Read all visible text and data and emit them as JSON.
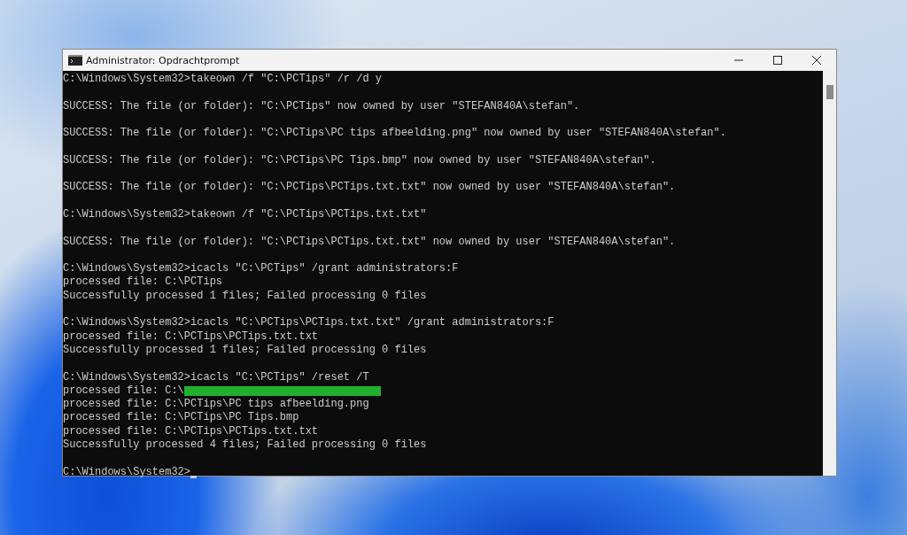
{
  "window": {
    "title": "Administrator: Opdrachtprompt"
  },
  "console": {
    "lines": [
      {
        "kind": "text",
        "text": "C:\\Windows\\System32>takeown /f \"C:\\PCTips\" /r /d y"
      },
      {
        "kind": "blank"
      },
      {
        "kind": "text",
        "text": "SUCCESS: The file (or folder): \"C:\\PCTips\" now owned by user \"STEFAN840A\\stefan\"."
      },
      {
        "kind": "blank"
      },
      {
        "kind": "text",
        "text": "SUCCESS: The file (or folder): \"C:\\PCTips\\PC tips afbeelding.png\" now owned by user \"STEFAN840A\\stefan\"."
      },
      {
        "kind": "blank"
      },
      {
        "kind": "text",
        "text": "SUCCESS: The file (or folder): \"C:\\PCTips\\PC Tips.bmp\" now owned by user \"STEFAN840A\\stefan\"."
      },
      {
        "kind": "blank"
      },
      {
        "kind": "text",
        "text": "SUCCESS: The file (or folder): \"C:\\PCTips\\PCTips.txt.txt\" now owned by user \"STEFAN840A\\stefan\"."
      },
      {
        "kind": "blank"
      },
      {
        "kind": "text",
        "text": "C:\\Windows\\System32>takeown /f \"C:\\PCTips\\PCTips.txt.txt\""
      },
      {
        "kind": "blank"
      },
      {
        "kind": "text",
        "text": "SUCCESS: The file (or folder): \"C:\\PCTips\\PCTips.txt.txt\" now owned by user \"STEFAN840A\\stefan\"."
      },
      {
        "kind": "blank"
      },
      {
        "kind": "text",
        "text": "C:\\Windows\\System32>icacls \"C:\\PCTips\" /grant administrators:F"
      },
      {
        "kind": "text",
        "text": "processed file: C:\\PCTips"
      },
      {
        "kind": "text",
        "text": "Successfully processed 1 files; Failed processing 0 files"
      },
      {
        "kind": "blank"
      },
      {
        "kind": "text",
        "text": "C:\\Windows\\System32>icacls \"C:\\PCTips\\PCTips.txt.txt\" /grant administrators:F"
      },
      {
        "kind": "text",
        "text": "processed file: C:\\PCTips\\PCTips.txt.txt"
      },
      {
        "kind": "text",
        "text": "Successfully processed 1 files; Failed processing 0 files"
      },
      {
        "kind": "blank"
      },
      {
        "kind": "text",
        "text": "C:\\Windows\\System32>icacls \"C:\\PCTips\" /reset /T"
      },
      {
        "kind": "redacted",
        "text": "processed file: C:\\"
      },
      {
        "kind": "text",
        "text": "processed file: C:\\PCTips\\PC tips afbeelding.png"
      },
      {
        "kind": "text",
        "text": "processed file: C:\\PCTips\\PC Tips.bmp"
      },
      {
        "kind": "text",
        "text": "processed file: C:\\PCTips\\PCTips.txt.txt"
      },
      {
        "kind": "text",
        "text": "Successfully processed 4 files; Failed processing 0 files"
      },
      {
        "kind": "blank"
      },
      {
        "kind": "prompt",
        "text": "C:\\Windows\\System32>"
      }
    ]
  }
}
